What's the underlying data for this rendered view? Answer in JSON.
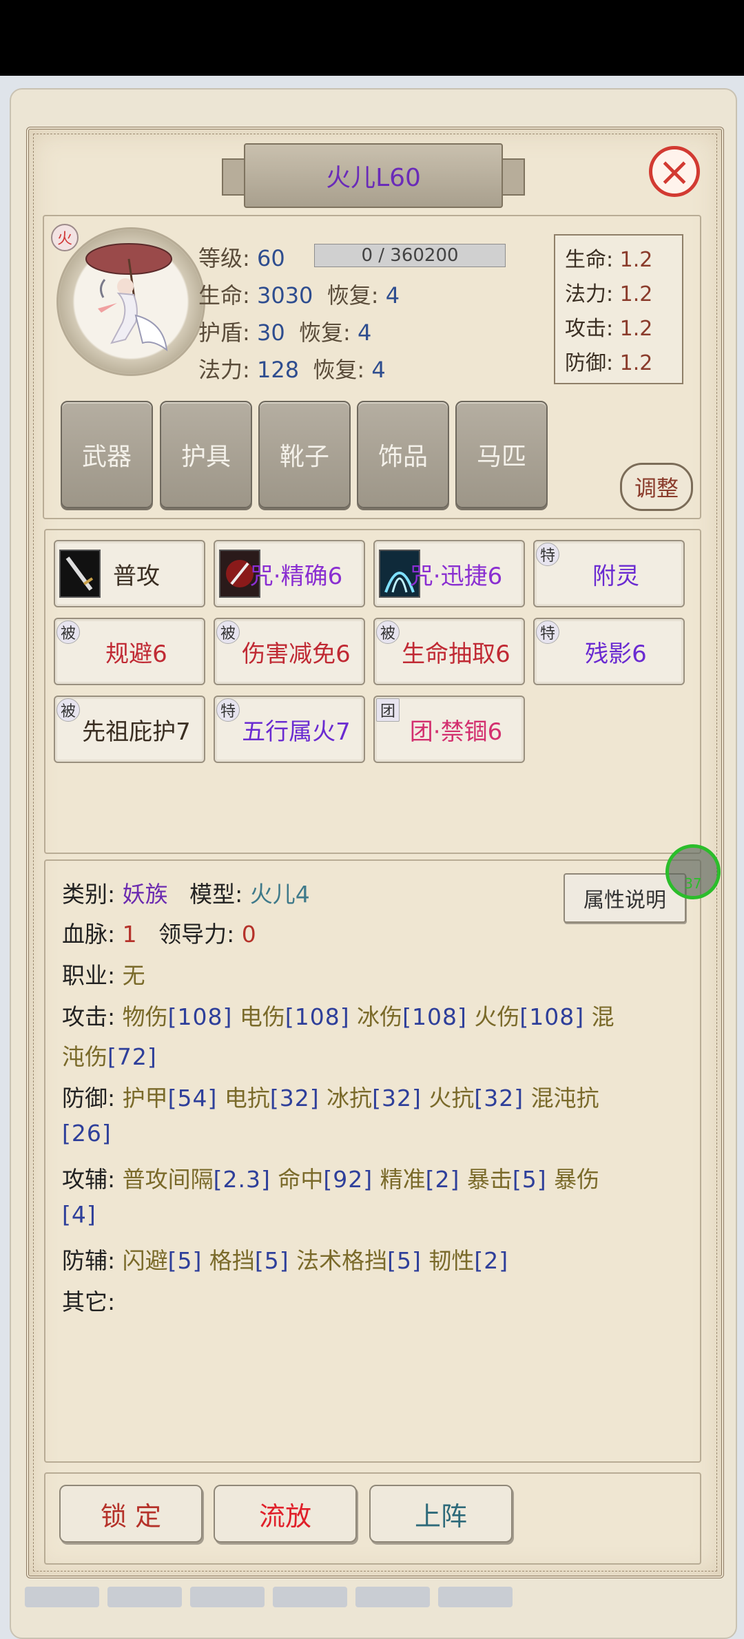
{
  "window": {
    "title": "火儿L60"
  },
  "pet": {
    "element_badge": "火",
    "level_label": "等级:",
    "level": "60",
    "exp": "0 / 360200",
    "hp_label": "生命:",
    "hp": "3030",
    "hp_regen_label": "恢复:",
    "hp_regen": "4",
    "shield_label": "护盾:",
    "shield": "30",
    "shield_regen_label": "恢复:",
    "shield_regen": "4",
    "mp_label": "法力:",
    "mp": "128",
    "mp_regen_label": "恢复:",
    "mp_regen": "4"
  },
  "growth": [
    {
      "label": "生命:",
      "value": "1.2"
    },
    {
      "label": "法力:",
      "value": "1.2"
    },
    {
      "label": "攻击:",
      "value": "1.2"
    },
    {
      "label": "防御:",
      "value": "1.2"
    }
  ],
  "equipment": [
    "武器",
    "护具",
    "靴子",
    "饰品",
    "马匹"
  ],
  "adjust_label": "调整",
  "skills": [
    {
      "tag": "",
      "name": "普攻"
    },
    {
      "tag": "",
      "name": "咒·精确6"
    },
    {
      "tag": "",
      "name": "咒·迅捷6"
    },
    {
      "tag": "特",
      "name": "附灵"
    },
    {
      "tag": "被",
      "name": "规避6"
    },
    {
      "tag": "被",
      "name": "伤害减免6"
    },
    {
      "tag": "被",
      "name": "生命抽取6"
    },
    {
      "tag": "特",
      "name": "残影6"
    },
    {
      "tag": "被",
      "name": "先祖庇护7"
    },
    {
      "tag": "特",
      "name": "五行属火7"
    },
    {
      "tag": "团",
      "name": "团·禁锢6"
    }
  ],
  "info": {
    "category_label": "类别:",
    "category": "妖族",
    "model_label": "模型:",
    "model": "火儿4",
    "bloodline_label": "血脉:",
    "bloodline": "1",
    "leadership_label": "领导力:",
    "leadership": "0",
    "job_label": "职业:",
    "job": "无",
    "attack_label": "攻击:",
    "attack_1": [
      "物伤",
      "[108]",
      "电伤",
      "[108]",
      "冰伤",
      "[108]",
      "火伤",
      "[108]",
      "混"
    ],
    "attack_2": [
      "沌伤",
      "[72]"
    ],
    "defense_label": "防御:",
    "defense_1": [
      "护甲",
      "[54]",
      "电抗",
      "[32]",
      "冰抗",
      "[32]",
      "火抗",
      "[32]",
      "混沌抗"
    ],
    "defense_2": [
      "[26]"
    ],
    "atk_aux_label": "攻辅:",
    "atk_aux_1": [
      "普攻间隔",
      "[2.3]",
      "命中",
      "[92]",
      "精准",
      "[2]",
      "暴击",
      "[5]",
      "暴伤"
    ],
    "atk_aux_2": [
      "[4]"
    ],
    "def_aux_label": "防辅:",
    "def_aux_1": [
      "闪避",
      "[5]",
      "格挡",
      "[5]",
      "法术格挡",
      "[5]",
      "韧性",
      "[2]"
    ],
    "other_label": "其它:",
    "attr_button": "属性说明"
  },
  "float_button_badge": "37",
  "actions": {
    "lock": "锁 定",
    "release": "流放",
    "deploy": "上阵"
  }
}
